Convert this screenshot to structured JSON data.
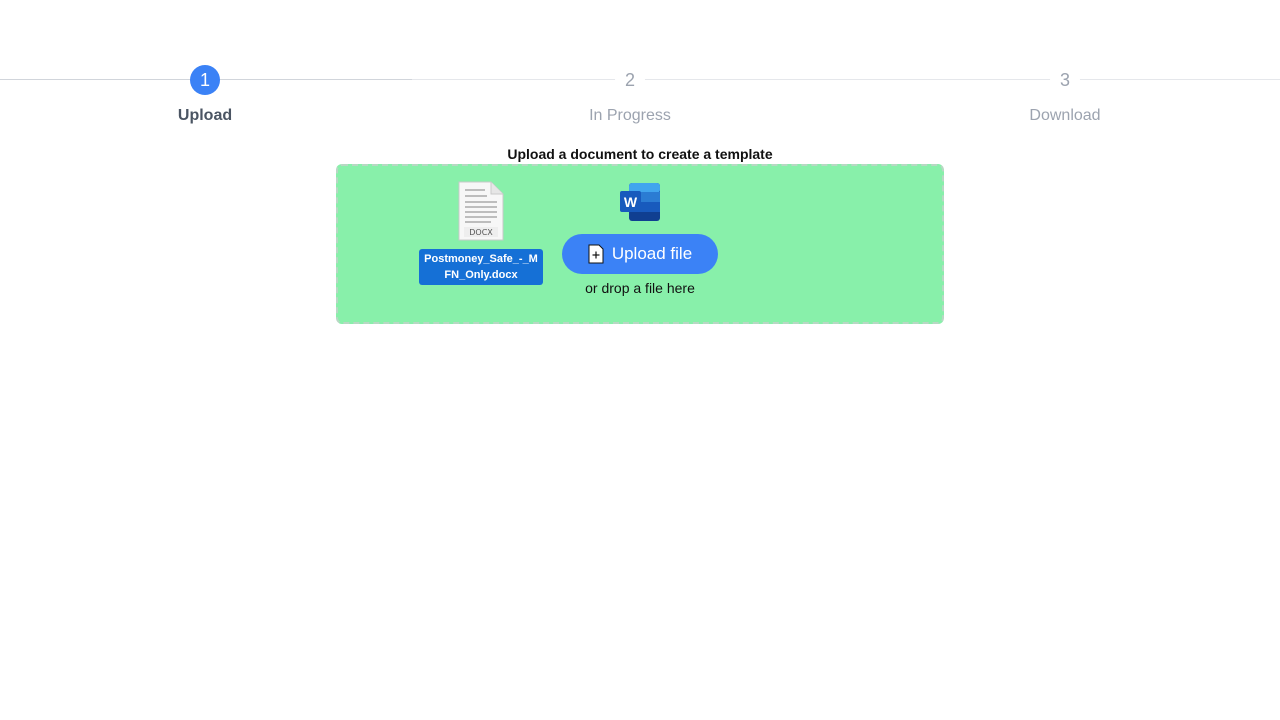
{
  "steps": [
    {
      "number": "1",
      "label": "Upload",
      "active": true
    },
    {
      "number": "2",
      "label": "In Progress",
      "active": false
    },
    {
      "number": "3",
      "label": "Download",
      "active": false
    }
  ],
  "upload": {
    "title": "Upload a document to create a template",
    "button_label": "Upload file",
    "drop_hint": "or drop a file here",
    "dropzone_color": "#88f0aa",
    "accent_color": "#3b82f6"
  },
  "dragged_file": {
    "name": "Postmoney_Safe_-_MFN_Only.docx",
    "thumb_label": "DOCX",
    "icon": "docx-file-icon"
  },
  "word_app": {
    "letter": "W",
    "icon": "microsoft-word-icon"
  }
}
